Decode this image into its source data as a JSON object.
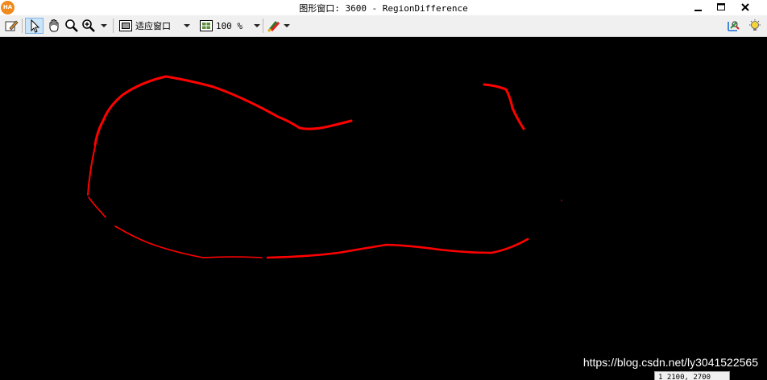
{
  "window": {
    "title": "图形窗口: 3600 - RegionDifference",
    "logo_text": "HA"
  },
  "toolbar": {
    "fit_window_label": "适应窗口",
    "zoom_label": "100 %",
    "items": [
      {
        "name": "edit-icon"
      },
      {
        "name": "pointer-icon"
      },
      {
        "name": "hand-pan-icon"
      },
      {
        "name": "zoom-icon"
      },
      {
        "name": "zoom-in-icon"
      },
      {
        "name": "fit-window-icon"
      },
      {
        "name": "zoom-level-icon"
      },
      {
        "name": "color-settings-icon"
      },
      {
        "name": "region-tool-icon"
      },
      {
        "name": "light-bulb-icon"
      }
    ]
  },
  "canvas": {
    "background": "#000000",
    "region_color": "#ff0000"
  },
  "watermark": "https://blog.csdn.net/ly3041522565",
  "status_popup": "1 2100, 2700"
}
